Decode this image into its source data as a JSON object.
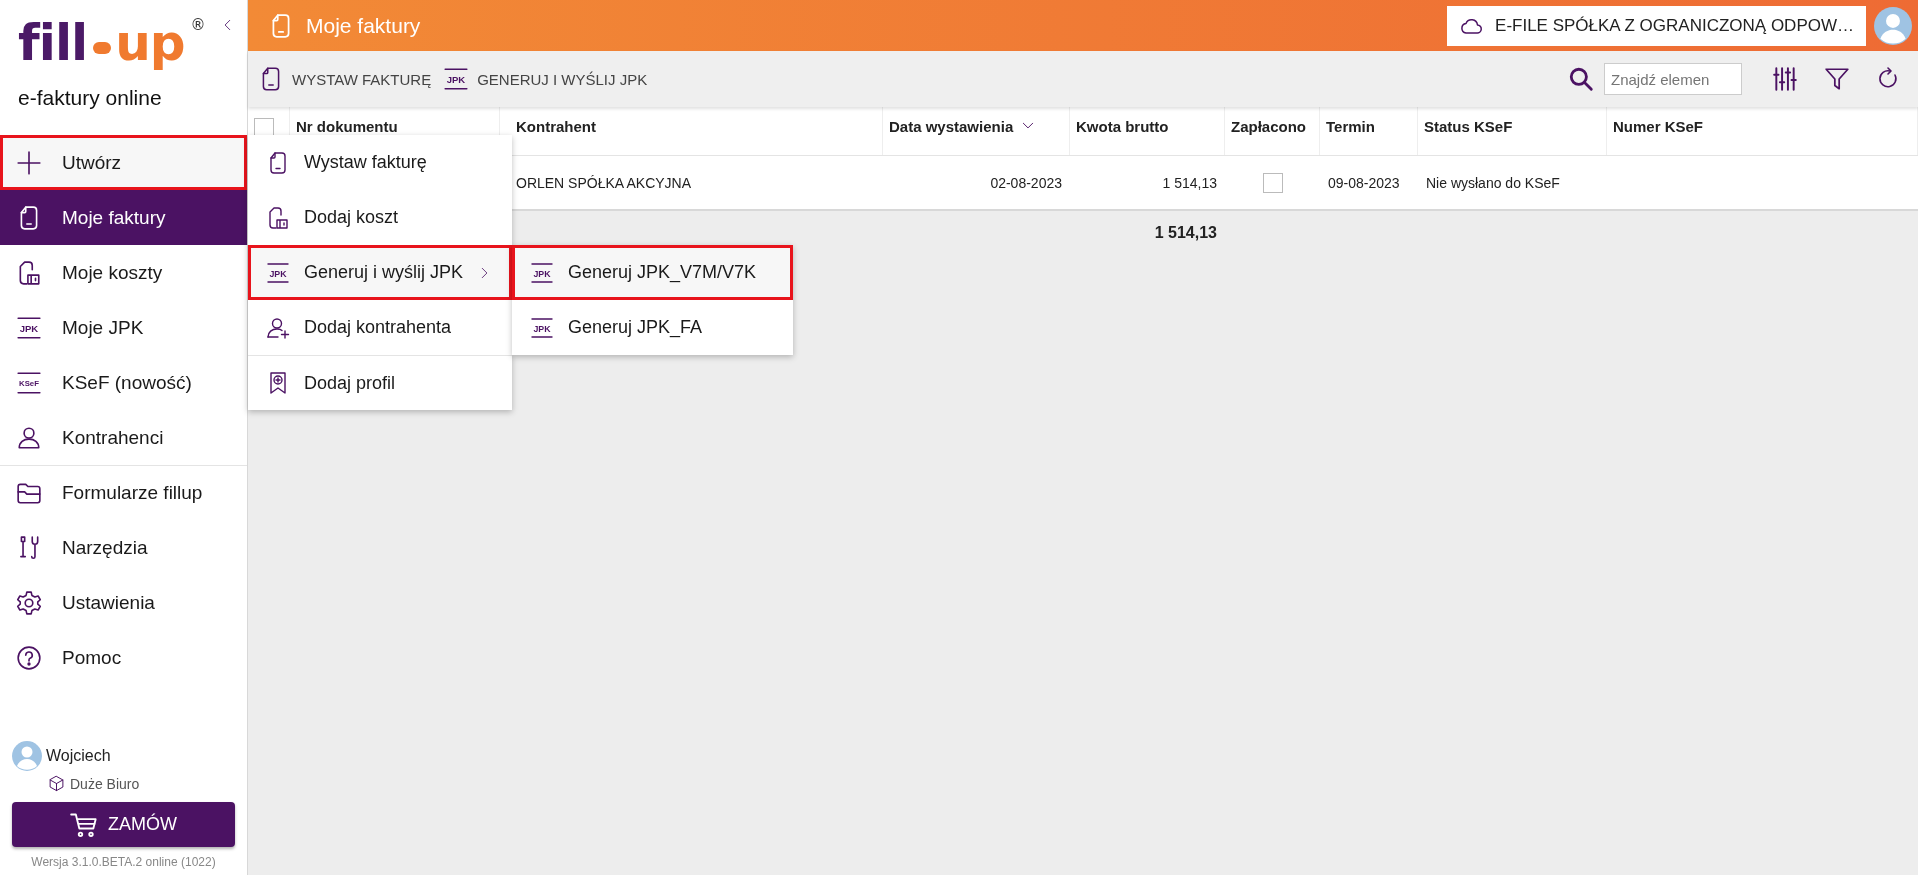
{
  "sidebar": {
    "logo": {
      "left": "fill",
      "right": "up",
      "mark": "®"
    },
    "subtitle": "e-faktury online",
    "nav": [
      {
        "label": "Utwórz",
        "kind": "plus",
        "selected": false,
        "highlighted": true,
        "divider_before": false
      },
      {
        "label": "Moje faktury",
        "kind": "invoice",
        "selected": true,
        "highlighted": false,
        "divider_before": false
      },
      {
        "label": "Moje koszty",
        "kind": "cost",
        "selected": false,
        "highlighted": false,
        "divider_before": false
      },
      {
        "label": "Moje JPK",
        "kind": "jpk",
        "icon_text": "JPK",
        "selected": false,
        "highlighted": false,
        "divider_before": false
      },
      {
        "label": "KSeF (nowość)",
        "kind": "ksef",
        "icon_text": "KSeF",
        "selected": false,
        "highlighted": false,
        "divider_before": false
      },
      {
        "label": "Kontrahenci",
        "kind": "person",
        "selected": false,
        "highlighted": false,
        "divider_before": false
      },
      {
        "label": "Formularze fillup",
        "kind": "folder",
        "selected": false,
        "highlighted": false,
        "divider_before": true
      },
      {
        "label": "Narzędzia",
        "kind": "tools",
        "selected": false,
        "highlighted": false,
        "divider_before": false
      },
      {
        "label": "Ustawienia",
        "kind": "gear",
        "selected": false,
        "highlighted": false,
        "divider_before": false
      },
      {
        "label": "Pomoc",
        "kind": "help",
        "selected": false,
        "highlighted": false,
        "divider_before": false
      }
    ],
    "user": {
      "name": "Wojciech",
      "plan": "Duże Biuro"
    },
    "order_button": "ZAMÓW",
    "version": "Wersja 3.1.0.BETA.2 online (1022)"
  },
  "header": {
    "title": "Moje faktury",
    "company": "E-FILE SPÓŁKA Z OGRANICZONĄ ODPOW…"
  },
  "toolbar": {
    "actions": [
      {
        "label": "WYSTAW FAKTURĘ",
        "kind": "invoice"
      },
      {
        "label": "GENERUJ I WYŚLIJ JPK",
        "kind": "jpk",
        "icon_text": "JPK"
      }
    ],
    "search": {
      "placeholder": "Znajdź elemen"
    }
  },
  "table": {
    "select_all": false,
    "columns": [
      {
        "label": "Nr dokumentu",
        "sorted": false
      },
      {
        "label": "Kontrahent",
        "sorted": false
      },
      {
        "label": "Data wystawienia",
        "sorted": true
      },
      {
        "label": "Kwota brutto",
        "sorted": false
      },
      {
        "label": "Zapłacono",
        "sorted": false
      },
      {
        "label": "Termin",
        "sorted": false
      },
      {
        "label": "Status KSeF",
        "sorted": false
      },
      {
        "label": "Numer KSeF",
        "sorted": false
      }
    ],
    "rows": [
      {
        "contractor": "ORLEN SPÓŁKA AKCYJNA",
        "issue_date": "02-08-2023",
        "gross": "1 514,13",
        "paid": false,
        "due": "09-08-2023",
        "ksef_status": "Nie wysłano do KSeF"
      }
    ],
    "total": "1 514,13"
  },
  "menu": {
    "items": [
      {
        "label": "Wystaw fakturę",
        "kind": "invoice",
        "highlighted": false,
        "has_submenu": false,
        "divider_before": false
      },
      {
        "label": "Dodaj koszt",
        "kind": "cost",
        "highlighted": false,
        "has_submenu": false,
        "divider_before": false
      },
      {
        "label": "Generuj i wyślij JPK",
        "kind": "jpk",
        "icon_text": "JPK",
        "highlighted": true,
        "has_submenu": true,
        "divider_before": false
      },
      {
        "label": "Dodaj kontrahenta",
        "kind": "person-add",
        "highlighted": false,
        "has_submenu": false,
        "divider_before": false
      },
      {
        "label": "Dodaj profil",
        "kind": "profile",
        "highlighted": false,
        "has_submenu": false,
        "divider_before": true
      }
    ],
    "submenu": [
      {
        "label": "Generuj JPK_V7M/V7K",
        "kind": "jpk",
        "icon_text": "JPK",
        "highlighted": true
      },
      {
        "label": "Generuj JPK_FA",
        "kind": "jpk",
        "icon_text": "JPK",
        "highlighted": false
      }
    ]
  }
}
